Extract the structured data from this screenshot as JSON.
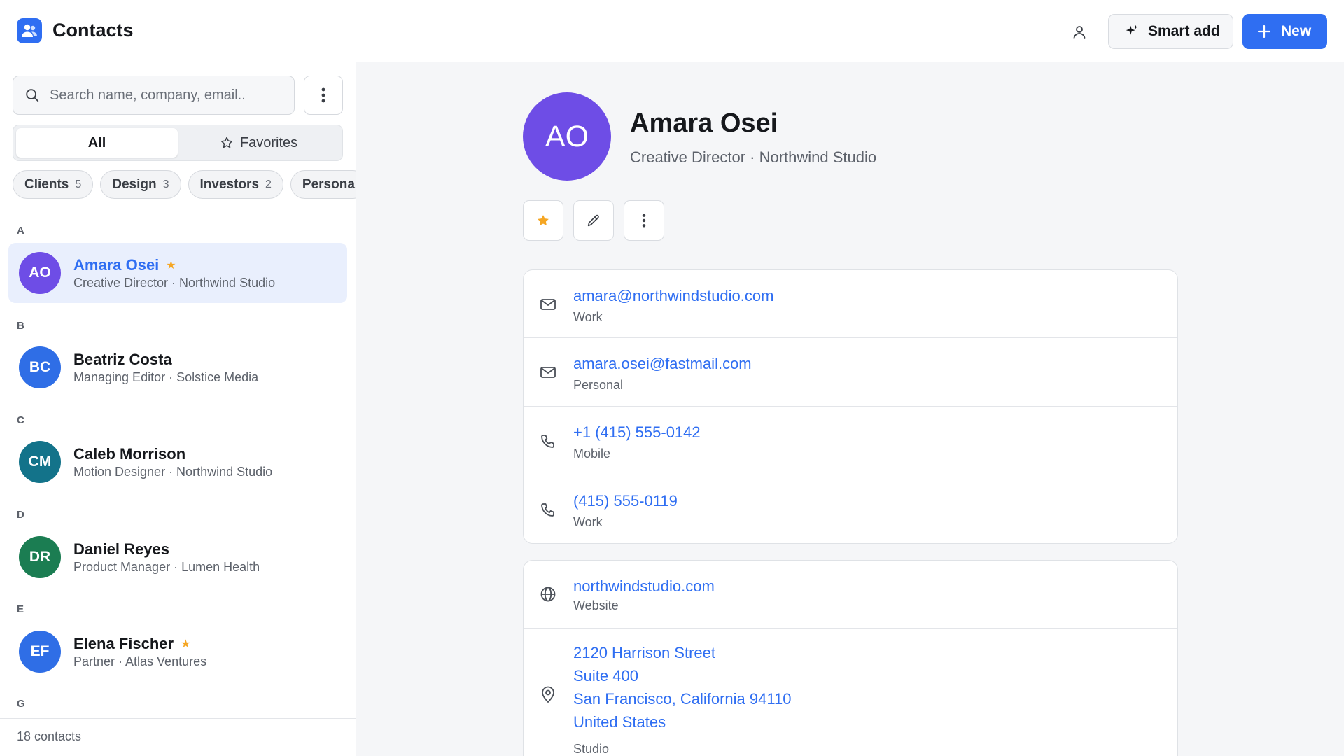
{
  "app": {
    "title": "Contacts"
  },
  "toolbar": {
    "smart_add_label": "Smart add",
    "new_label": "New"
  },
  "search": {
    "placeholder": "Search name, company, email.."
  },
  "filters": {
    "tabs": [
      {
        "label": "All"
      },
      {
        "label": "Favorites"
      }
    ],
    "chips": [
      {
        "label": "Clients",
        "count": "5"
      },
      {
        "label": "Design",
        "count": "3"
      },
      {
        "label": "Investors",
        "count": "2"
      },
      {
        "label": "Persona"
      }
    ]
  },
  "contacts": {
    "sections": [
      {
        "letter": "A"
      },
      {
        "letter": "B"
      },
      {
        "letter": "C"
      },
      {
        "letter": "D"
      },
      {
        "letter": "E"
      },
      {
        "letter": "G"
      }
    ],
    "items": [
      {
        "initials": "AO",
        "name": "Amara Osei",
        "subtitle": "Creative Director · Northwind Studio",
        "favorite": true,
        "color": "#6e4de6"
      },
      {
        "initials": "BC",
        "name": "Beatriz Costa",
        "subtitle": "Managing Editor · Solstice Media",
        "favorite": false,
        "color": "#2f6ee6"
      },
      {
        "initials": "CM",
        "name": "Caleb Morrison",
        "subtitle": "Motion Designer · Northwind Studio",
        "favorite": false,
        "color": "#13738a"
      },
      {
        "initials": "DR",
        "name": "Daniel Reyes",
        "subtitle": "Product Manager · Lumen Health",
        "favorite": false,
        "color": "#1b7d52"
      },
      {
        "initials": "EF",
        "name": "Elena Fischer",
        "subtitle": "Partner · Atlas Ventures",
        "favorite": true,
        "color": "#2f6ee6"
      }
    ],
    "count_label": "18 contacts"
  },
  "detail": {
    "initials": "AO",
    "name": "Amara Osei",
    "subtitle": "Creative Director · Northwind Studio",
    "contact_rows": [
      {
        "value": "amara@northwindstudio.com",
        "label": "Work",
        "icon": "mail-icon"
      },
      {
        "value": "amara.osei@fastmail.com",
        "label": "Personal",
        "icon": "mail-icon"
      },
      {
        "value": "+1 (415) 555-0142",
        "label": "Mobile",
        "icon": "phone-icon"
      },
      {
        "value": "(415) 555-0119",
        "label": "Work",
        "icon": "phone-icon"
      }
    ],
    "website": {
      "value": "northwindstudio.com",
      "label": "Website"
    },
    "address": {
      "lines": [
        "2120 Harrison Street",
        "Suite 400",
        "San Francisco, California 94110",
        "United States"
      ],
      "label": "Studio"
    }
  },
  "colors": {
    "accent": "#2f6ef2",
    "favorite": "#f5a623",
    "selected_row": "#e9effd"
  }
}
